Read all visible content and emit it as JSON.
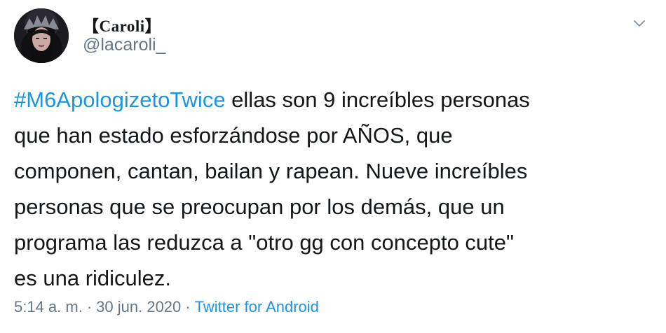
{
  "author": {
    "display_name": "【Caroli】",
    "handle": "@lacaroli_"
  },
  "tweet": {
    "hashtag": "#M6ApologizetoTwice",
    "lines": [
      " ellas son 9 increíbles personas",
      "que han estado esforzándose por AÑOS, que",
      "componen, cantan, bailan y rapean. Nueve increíbles",
      "personas que se preocupan por los demás, que un",
      "programa las reduzca a \"otro gg con concepto cute\"",
      "es una ridiculez."
    ]
  },
  "meta": {
    "time": "5:14 a. m.",
    "separator": "·",
    "date": "30 jun. 2020",
    "source": "Twitter for Android"
  },
  "icons": {
    "menu": "chevron-down-icon",
    "avatar": "profile-avatar"
  },
  "colors": {
    "link": "#1b95e0",
    "text": "#14171a",
    "secondary": "#657786"
  }
}
